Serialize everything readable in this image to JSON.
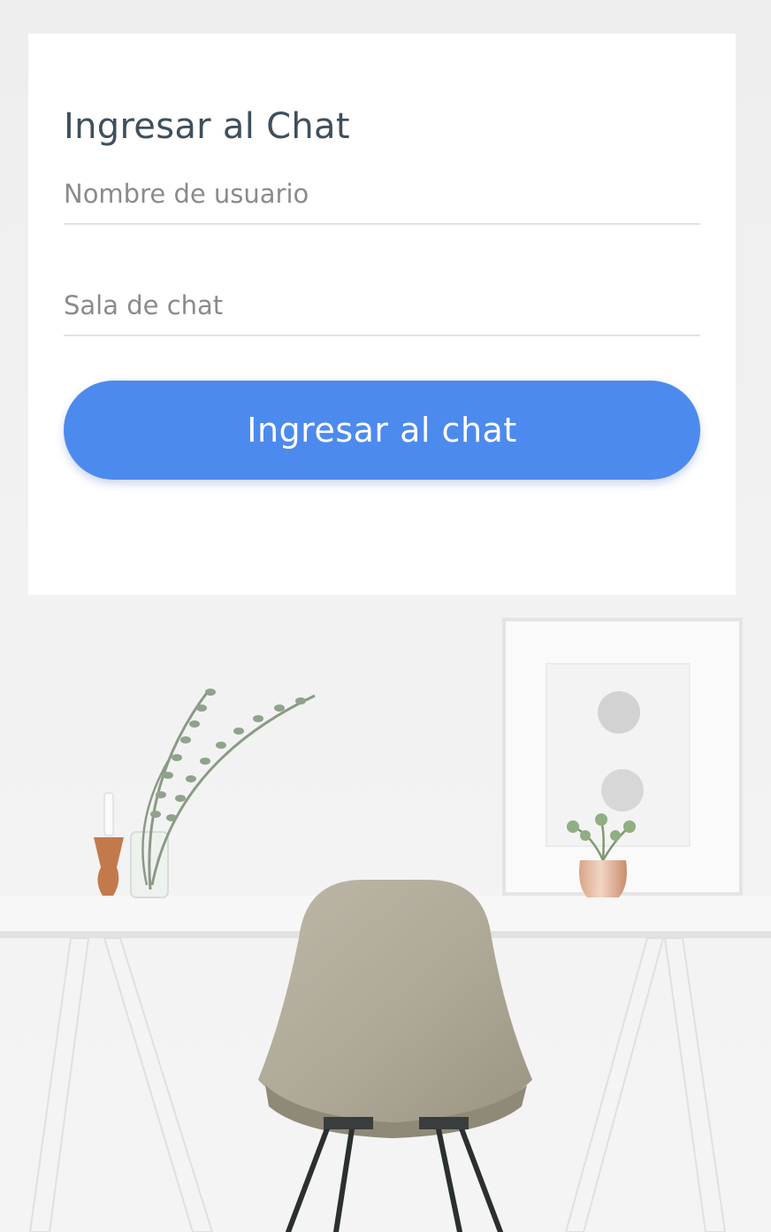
{
  "login_form": {
    "title": "Ingresar al Chat",
    "username_placeholder": "Nombre de usuario",
    "username_value": "",
    "room_placeholder": "Sala de chat",
    "room_value": "",
    "submit_label": "Ingresar al chat"
  },
  "theme": {
    "accent": "#4d8aee",
    "title_color": "#3f4f5b",
    "page_background": "#efefef"
  }
}
